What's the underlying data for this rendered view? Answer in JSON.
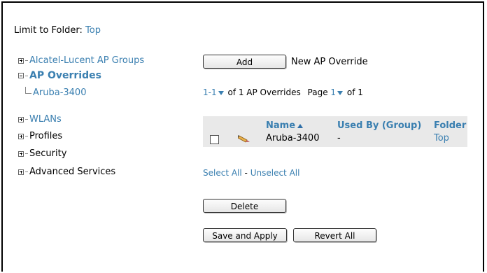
{
  "limit": {
    "label": "Limit to Folder:",
    "value": "Top"
  },
  "tree": {
    "alcatel": "Alcatel-Lucent AP Groups",
    "ap_overrides": "AP Overrides",
    "aruba": "Aruba-3400",
    "wlans": "WLANs",
    "profiles": "Profiles",
    "security": "Security",
    "advanced": "Advanced Services"
  },
  "add": {
    "button": "Add",
    "label": "New AP Override"
  },
  "pager": {
    "range": "1-1",
    "of_text": "of 1 AP Overrides",
    "page_label": "Page",
    "page": "1",
    "page_of": "of 1"
  },
  "table": {
    "headers": {
      "name": "Name",
      "used_by": "Used By (Group)",
      "folder": "Folder"
    },
    "rows": [
      {
        "name": "Aruba-3400",
        "used_by": "-",
        "folder": "Top"
      }
    ]
  },
  "selection": {
    "select_all": "Select All",
    "separator": "-",
    "unselect_all": "Unselect All"
  },
  "buttons": {
    "delete": "Delete",
    "save_apply": "Save and Apply",
    "revert_all": "Revert All"
  },
  "colors": {
    "link": "#3a7fb0",
    "header_text": "#3a7fb0",
    "table_bg": "#e9e9e9"
  }
}
